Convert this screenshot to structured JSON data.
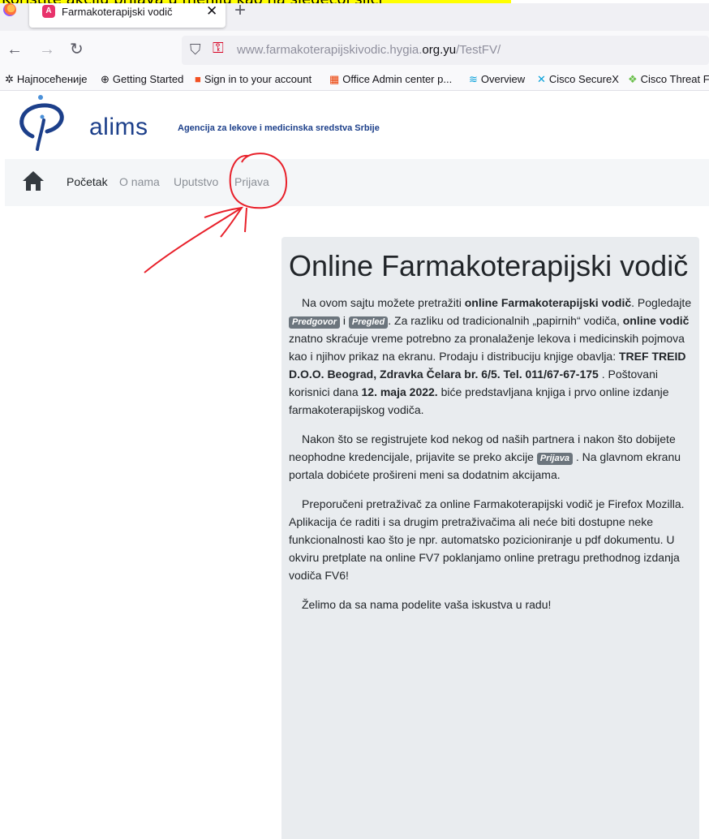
{
  "annotation_banner": "Koristite akciju prijava u meniju kao na sledećoj slici",
  "browser": {
    "tab_title": "Farmakoterapijski vodič",
    "tab_close": "✕",
    "new_tab": "+",
    "url_prefix": "www.farmakoterapijskivodic.hygia.",
    "url_domain": "org.yu",
    "url_path": "/TestFV/",
    "bookmarks": [
      {
        "icon": "gear-icon",
        "label": "Најпосећеније"
      },
      {
        "icon": "globe-icon",
        "label": "Getting Started"
      },
      {
        "icon": "microsoft-icon",
        "label": "Sign in to your account"
      },
      {
        "icon": "office-icon",
        "label": "Office Admin center p..."
      },
      {
        "icon": "cisco-icon",
        "label": "Overview"
      },
      {
        "icon": "securex-icon",
        "label": "Cisco SecureX"
      },
      {
        "icon": "threat-icon",
        "label": "Cisco Threat F"
      }
    ]
  },
  "site": {
    "brand": "alims",
    "agency": "Agencija za lekove i medicinska sredstva Srbije",
    "menu": [
      "Početak",
      "O nama",
      "Uputstvo",
      "Prijava"
    ],
    "colors": {
      "brand": "#1c3f8a",
      "card": "#e9ecef",
      "menubar": "#f4f6f8",
      "annotation": "#e8202a"
    }
  },
  "content": {
    "title": "Online Farmakoterapijski vodič",
    "p1": {
      "t1": "Na ovom sajtu možete pretražiti ",
      "b1": "online Farmakoterapijski vodič",
      "t2": ". Pogledajte ",
      "pill1": "Predgovor",
      "t3": " i ",
      "pill2": "Pregled",
      "t4": ". Za razliku od tradicionalnih „papirnih“ vodiča, ",
      "b2": "online vodič",
      "t5": " znatno skraćuje vreme potrebno za pronalaženje lekova i medicinskih pojmova kao i njihov prikaz na ekranu. Prodaju i distribuciju knjige obavlja: ",
      "b3": "TREF TREID D.O.O. Beograd, Zdravka Čelara br. 6/5. Tel. 011/67-67-175",
      "t6": " . Poštovani korisnici dana ",
      "b4": "12. maja 2022.",
      "t7": " biće predstavljana knjiga i prvo online izdanje farmakoterapijskog vodiča."
    },
    "p2": {
      "t1": "Nakon što se registrujete kod nekog od naših partnera i nakon što dobijete neophodne kredencijale, prijavite se preko akcije ",
      "pill": "Prijava",
      "t2": " . Na glavnom ekranu portala dobićete prošireni meni sa dodatnim akcijama."
    },
    "p3": "Preporučeni pretraživač za online Farmakoterapijski vodič je Firefox Mozilla. Aplikacija će raditi i sa drugim pretraživačima ali neće biti dostupne neke funkcionalnosti kao što je npr. automatsko pozicioniranje u pdf dokumentu. U okviru pretplate na online FV7 poklanjamo online pretragu prethodnog izdanja vodiča FV6!",
    "p4": "Želimo da sa nama podelite vaša iskustva u radu!"
  }
}
